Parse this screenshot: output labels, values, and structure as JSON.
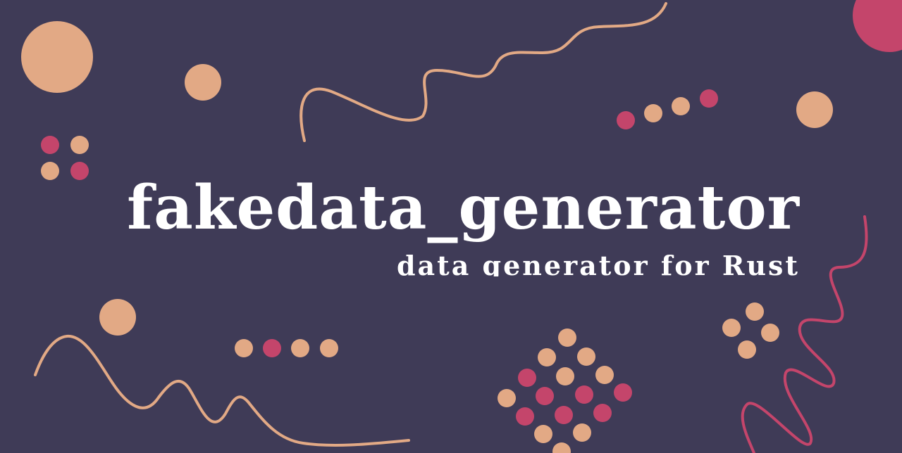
{
  "banner": {
    "title": "fakedata_generator",
    "subtitle": "data generator for Rust"
  },
  "colors": {
    "background": "#3f3b57",
    "peach": "#e2a985",
    "pink": "#c4456b",
    "text": "#ffffff"
  }
}
